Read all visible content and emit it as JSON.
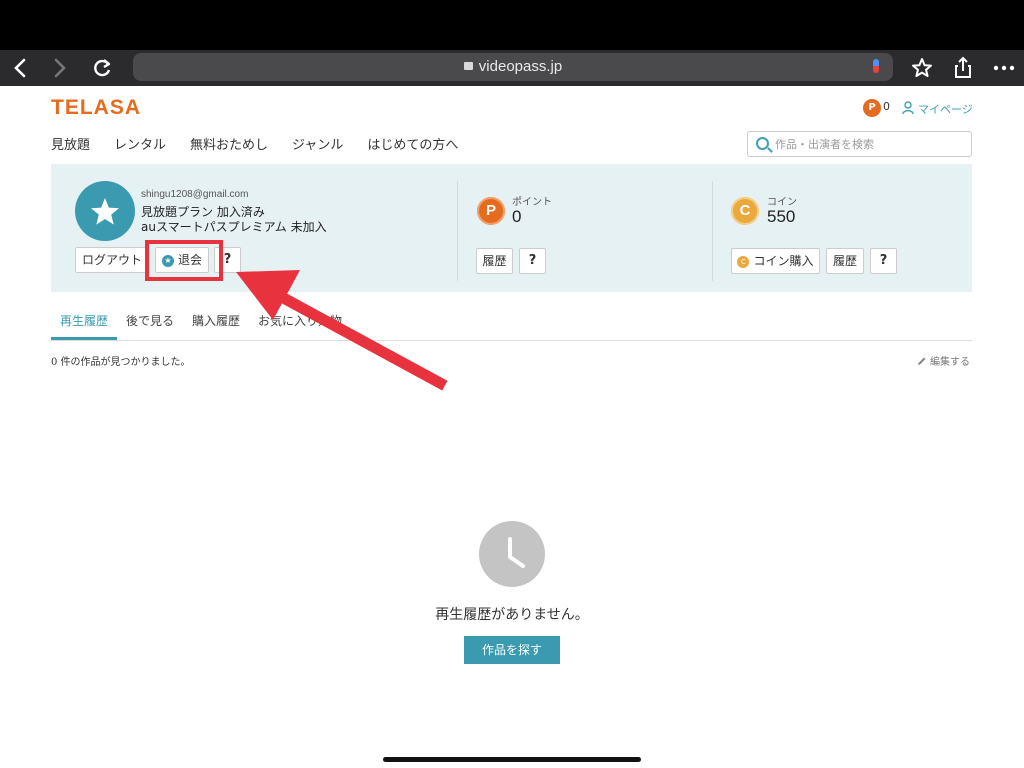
{
  "browser": {
    "url": "videopass.jp",
    "back_icon": "chevron-left-icon",
    "forward_icon": "chevron-right-icon",
    "reload_icon": "reload-icon",
    "bookmark_icon": "star-icon",
    "share_icon": "share-icon",
    "more_icon": "more-icon"
  },
  "header": {
    "logo_text": "TELASA",
    "points_badge": "P",
    "points_value": "0",
    "mypage_label": "マイページ"
  },
  "nav": {
    "items": [
      "見放題",
      "レンタル",
      "無料おためし",
      "ジャンル",
      "はじめての方へ"
    ]
  },
  "search": {
    "placeholder": "作品・出演者を検索"
  },
  "account": {
    "email": "shingu1208@gmail.com",
    "plan_line1": "見放題プラン 加入済み",
    "plan_line2": "auスマートパスプレミアム 未加入",
    "logout_label": "ログアウト",
    "withdraw_label": "退会",
    "help_label": "?"
  },
  "points": {
    "icon_letter": "P",
    "label": "ポイント",
    "value": "0",
    "history_label": "履歴",
    "help_label": "?"
  },
  "coins": {
    "icon_letter": "C",
    "label": "コイン",
    "value": "550",
    "buy_icon_letter": "C",
    "buy_label": "コイン購入",
    "history_label": "履歴",
    "help_label": "?"
  },
  "tabs": [
    "再生履歴",
    "後で見る",
    "購入履歴",
    "お気に入り人物"
  ],
  "list": {
    "count_text": "0 件の作品が見つかりました。",
    "edit_label": "編集する"
  },
  "empty": {
    "message": "再生履歴がありません。",
    "find_button": "作品を探す"
  },
  "colors": {
    "accent": "#3a9ab0",
    "brand_orange": "#e56b1f",
    "coin_gold": "#eaa83d",
    "highlight_red": "#e8333f"
  }
}
